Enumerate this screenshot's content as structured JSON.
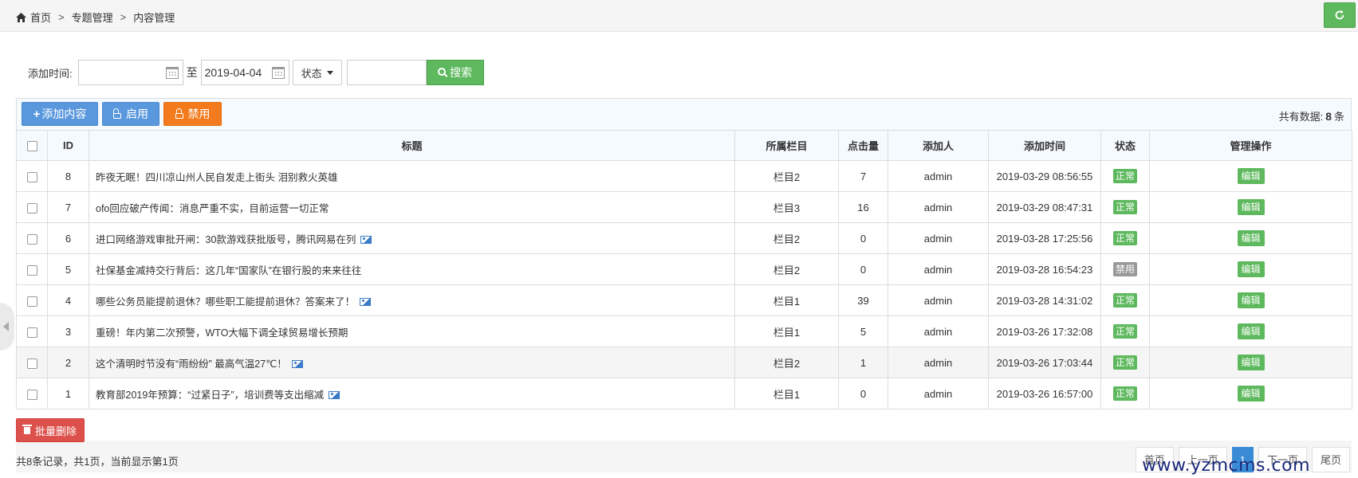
{
  "breadcrumb": {
    "home": "首页",
    "sep": ">",
    "level2": "专题管理",
    "level3": "内容管理"
  },
  "search": {
    "label": "添加时间:",
    "start_date": "",
    "to": "至",
    "end_date": "2019-04-04",
    "status_label": "状态",
    "keyword": "",
    "search_label": "搜索"
  },
  "toolbar": {
    "add_label": "添加内容",
    "enable_label": "启用",
    "disable_label": "禁用",
    "total_prefix": "共有数据:",
    "total_count": "8",
    "total_suffix": "条"
  },
  "table": {
    "headers": [
      "ID",
      "标题",
      "所属栏目",
      "点击量",
      "添加人",
      "添加时间",
      "状态",
      "管理操作"
    ],
    "rows": [
      {
        "id": "8",
        "title": "昨夜无眠！四川凉山州人民自发走上街头 泪别救火英雄",
        "has_image": false,
        "column": "栏目2",
        "hits": "7",
        "author": "admin",
        "time": "2019-03-29 08:56:55",
        "status": "正常",
        "status_type": "ok",
        "action": "编辑"
      },
      {
        "id": "7",
        "title": "ofo回应破产传闻：消息严重不实，目前运营一切正常",
        "has_image": false,
        "column": "栏目3",
        "hits": "16",
        "author": "admin",
        "time": "2019-03-29 08:47:31",
        "status": "正常",
        "status_type": "ok",
        "action": "编辑"
      },
      {
        "id": "6",
        "title": "进口网络游戏审批开闸：30款游戏获批版号，腾讯网易在列",
        "has_image": true,
        "column": "栏目2",
        "hits": "0",
        "author": "admin",
        "time": "2019-03-28 17:25:56",
        "status": "正常",
        "status_type": "ok",
        "action": "编辑"
      },
      {
        "id": "5",
        "title": "社保基金减持交行背后：这几年“国家队”在银行股的来来往往",
        "has_image": false,
        "column": "栏目2",
        "hits": "0",
        "author": "admin",
        "time": "2019-03-28 16:54:23",
        "status": "禁用",
        "status_type": "off",
        "action": "编辑"
      },
      {
        "id": "4",
        "title": "哪些公务员能提前退休？哪些职工能提前退休？答案来了！",
        "has_image": true,
        "column": "栏目1",
        "hits": "39",
        "author": "admin",
        "time": "2019-03-28 14:31:02",
        "status": "正常",
        "status_type": "ok",
        "action": "编辑"
      },
      {
        "id": "3",
        "title": "重磅！年内第二次预警，WTO大幅下调全球贸易增长预期",
        "has_image": false,
        "column": "栏目1",
        "hits": "5",
        "author": "admin",
        "time": "2019-03-26 17:32:08",
        "status": "正常",
        "status_type": "ok",
        "action": "编辑"
      },
      {
        "id": "2",
        "title": "这个清明时节没有“雨纷纷” 最高气温27℃！",
        "has_image": true,
        "column": "栏目2",
        "hits": "1",
        "author": "admin",
        "time": "2019-03-26 17:03:44",
        "status": "正常",
        "status_type": "ok",
        "action": "编辑"
      },
      {
        "id": "1",
        "title": "教育部2019年预算：“过紧日子”，培训费等支出缩减",
        "has_image": true,
        "column": "栏目1",
        "hits": "0",
        "author": "admin",
        "time": "2019-03-26 16:57:00",
        "status": "正常",
        "status_type": "ok",
        "action": "编辑"
      }
    ]
  },
  "footer": {
    "batch_delete": "批量删除",
    "record_info": "共8条记录，共1页，当前显示第1页",
    "pager": [
      "首页",
      "上一页",
      "1",
      "下一页",
      "尾页"
    ]
  },
  "watermark": "www.yzmcms.com",
  "colors": {
    "green": "#5eb95e",
    "blue": "#5a98de",
    "orange": "#f37b1d",
    "red": "#dd514c",
    "gray": "#999999"
  }
}
